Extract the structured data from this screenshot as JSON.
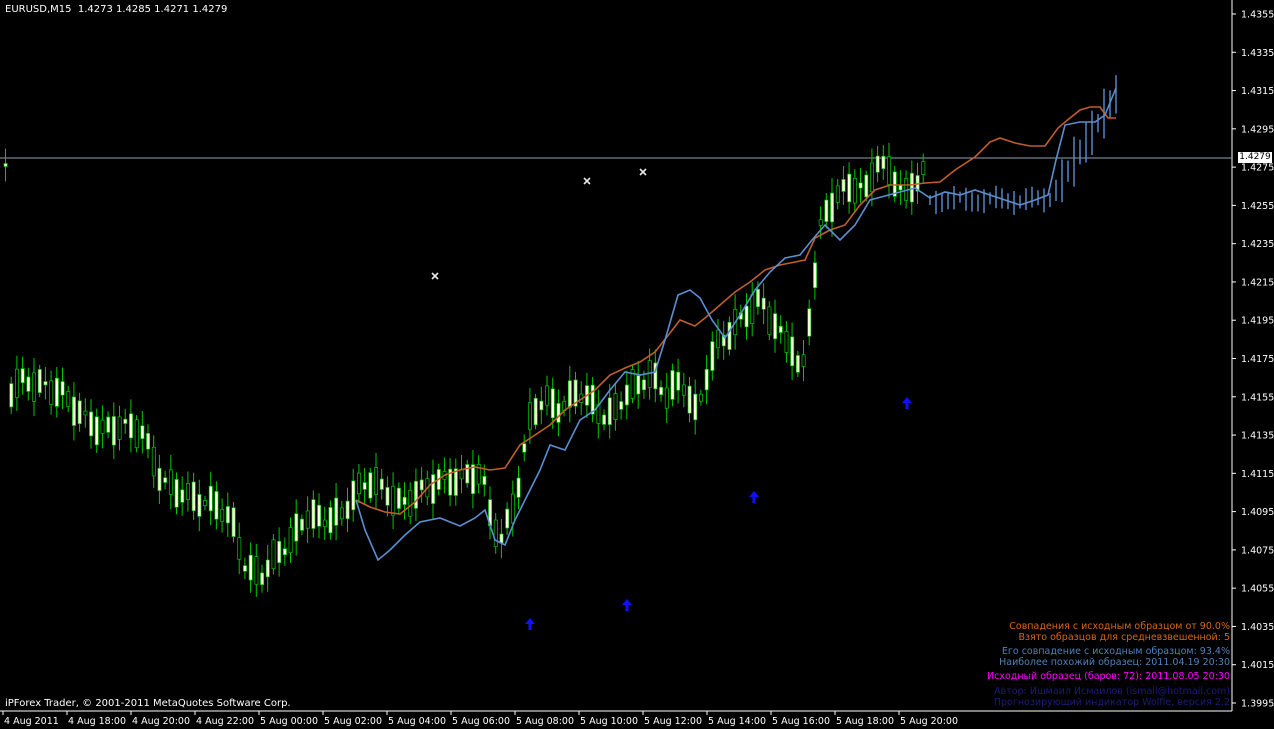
{
  "chart": {
    "title": "EURUSD,M15  1.4273 1.4285 1.4271 1.4279",
    "copyright": "iPForex Trader, © 2001-2011 MetaQuotes Software Corp.",
    "last_price": "1.4279",
    "price_levels": [
      "1.4355",
      "1.4335",
      "1.4315",
      "1.4295",
      "1.4275",
      "1.4255",
      "1.4235",
      "1.4215",
      "1.4195",
      "1.4175",
      "1.4155",
      "1.4135",
      "1.4115",
      "1.4095",
      "1.4075",
      "1.4055",
      "1.4035",
      "1.4015",
      "1.3995"
    ],
    "time_labels": [
      "4 Aug 2011",
      "4 Aug 18:00",
      "4 Aug 20:00",
      "4 Aug 22:00",
      "5 Aug 00:00",
      "5 Aug 02:00",
      "5 Aug 04:00",
      "5 Aug 06:00",
      "5 Aug 08:00",
      "5 Aug 10:00",
      "5 Aug 12:00",
      "5 Aug 14:00",
      "5 Aug 16:00",
      "5 Aug 18:00",
      "5 Aug 20:00"
    ],
    "colors": {
      "background": "#000000",
      "axis": "#ffffff",
      "candle_bull": "#ffffe0",
      "candle_wick": "#00c800",
      "forecast_line": "#c05f2c",
      "match_line": "#5b8fd0",
      "arrow": "#1010ff",
      "marker": "#e6e6e6"
    }
  },
  "info": {
    "line1": "Совпадения с исходным образцом от 90.0%",
    "line2": "Взято образцов для средневзвешенной: 5",
    "line3": "Его совпадение с исходным образцом: 93.4%",
    "line4": "Наиболее похожий образец: 2011.04.19 20:30",
    "line5": "Исходный образец (баров: 72): 2011.08.05 20:30",
    "line6": "Автор: Ишмаил Исмаилов (ismail@hotmail.com)",
    "line7": "Прогнозирующий индикатор Wolfie, версия 2.2"
  }
}
